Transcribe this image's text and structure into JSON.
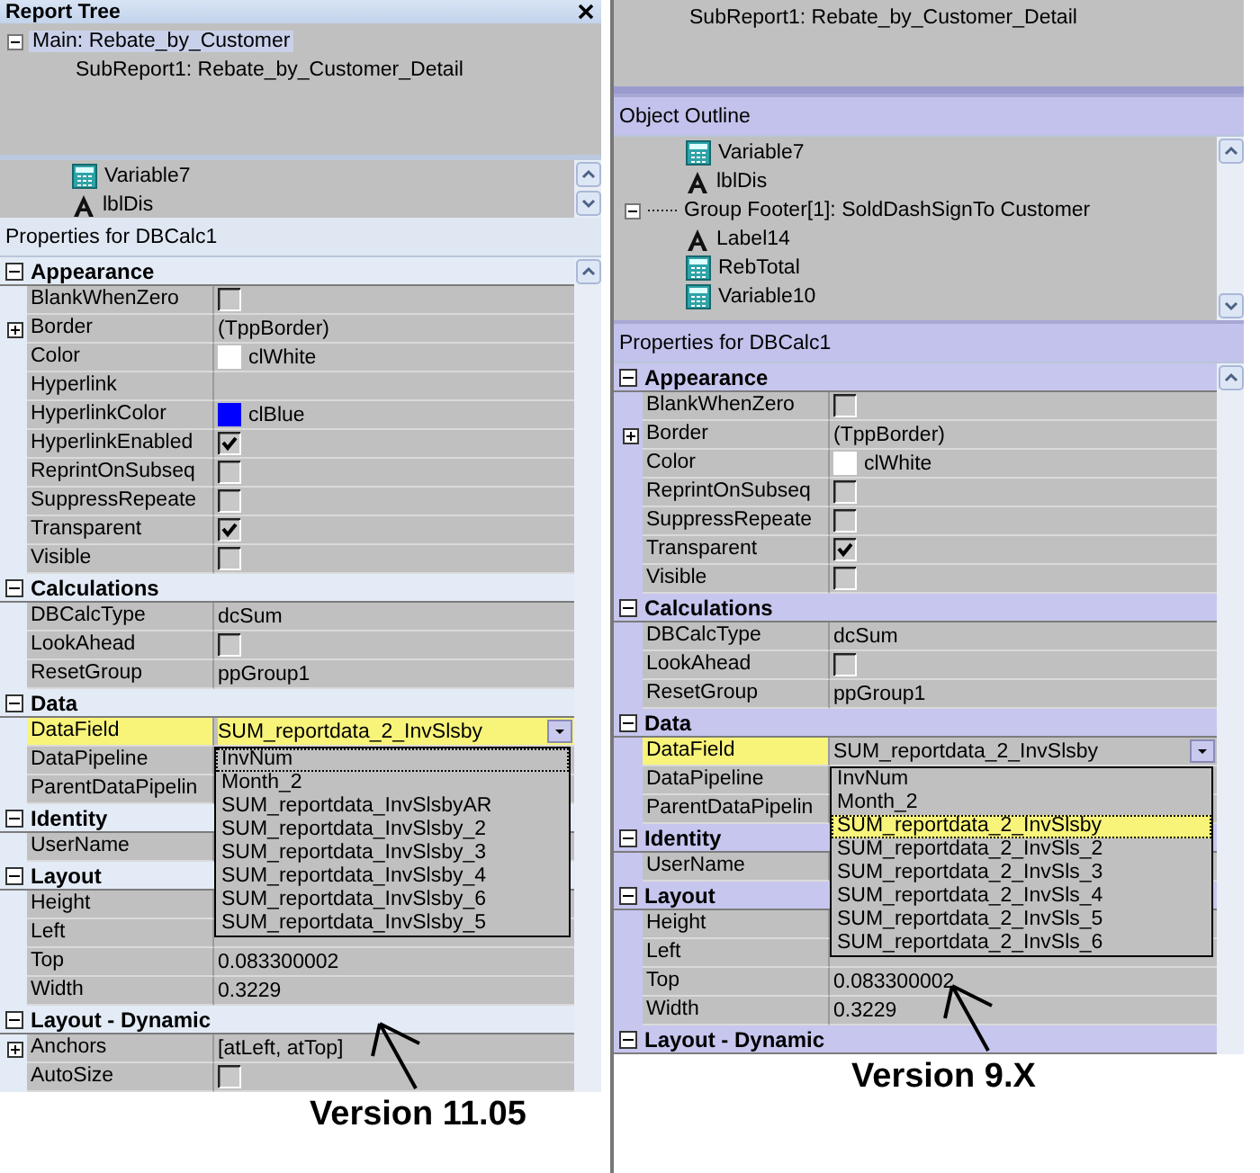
{
  "panels": [
    {
      "report_tree": {
        "title": "Report Tree",
        "items": [
          {
            "label": "Main: Rebate_by_Customer",
            "expanded": true,
            "selected": true,
            "children": [
              {
                "label": "SubReport1: Rebate_by_Customer_Detail",
                "selected": false
              }
            ]
          }
        ]
      },
      "outline": {
        "items": [
          {
            "label": "Variable7",
            "kind": "calc"
          },
          {
            "label": "lblDis",
            "kind": "label"
          }
        ]
      },
      "properties_title": "Properties for DBCalc1",
      "categories": [
        {
          "name": "Appearance",
          "expanded": true,
          "rows": [
            {
              "name": "BlankWhenZero",
              "kind": "checkbox",
              "checked": false,
              "selected": false
            },
            {
              "name": "Border",
              "kind": "expandable",
              "expanded": false,
              "value": "(TppBorder)",
              "selected": false
            },
            {
              "name": "Color",
              "kind": "color",
              "color": "#ffffff",
              "value": "clWhite",
              "selected": false
            },
            {
              "name": "Hyperlink",
              "kind": "text",
              "selected": false
            },
            {
              "name": "HyperlinkColor",
              "kind": "color",
              "color": "#0000ff",
              "value": "clBlue",
              "selected": false
            },
            {
              "name": "HyperlinkEnabled",
              "kind": "checkbox",
              "checked": true,
              "selected": false
            },
            {
              "name": "ReprintOnSubseq",
              "kind": "checkbox",
              "checked": false,
              "selected": false
            },
            {
              "name": "SuppressRepeate",
              "kind": "checkbox",
              "checked": false,
              "selected": false
            },
            {
              "name": "Transparent",
              "kind": "checkbox",
              "checked": true,
              "selected": false
            },
            {
              "name": "Visible",
              "kind": "checkbox",
              "checked": false,
              "selected": false
            }
          ]
        },
        {
          "name": "Calculations",
          "expanded": true,
          "rows": [
            {
              "name": "DBCalcType",
              "kind": "text",
              "value": "dcSum",
              "selected": false
            },
            {
              "name": "LookAhead",
              "kind": "checkbox",
              "checked": false,
              "selected": false
            },
            {
              "name": "ResetGroup",
              "kind": "text",
              "value": "ppGroup1",
              "selected": false
            }
          ]
        },
        {
          "name": "Data",
          "expanded": true,
          "rows": [
            {
              "name": "DataField",
              "kind": "dropdown",
              "value": "SUM_reportdata_2_InvSlsby",
              "selected": true,
              "options": [
                {
                  "label": "InvNum",
                  "selected": false,
                  "focused": true
                },
                {
                  "label": "Month_2",
                  "selected": false,
                  "focused": false
                },
                {
                  "label": "SUM_reportdata_InvSlsbyAR",
                  "selected": false,
                  "focused": false
                },
                {
                  "label": "SUM_reportdata_InvSlsby_2",
                  "selected": false,
                  "focused": false
                },
                {
                  "label": "SUM_reportdata_InvSlsby_3",
                  "selected": false,
                  "focused": false
                },
                {
                  "label": "SUM_reportdata_InvSlsby_4",
                  "selected": false,
                  "focused": false
                },
                {
                  "label": "SUM_reportdata_InvSlsby_6",
                  "selected": false,
                  "focused": false
                },
                {
                  "label": "SUM_reportdata_InvSlsby_5",
                  "selected": false,
                  "focused": false
                }
              ]
            },
            {
              "name": "DataPipeline",
              "kind": "text",
              "selected": false
            },
            {
              "name": "ParentDataPipelin",
              "kind": "text",
              "selected": false
            }
          ]
        },
        {
          "name": "Identity",
          "expanded": true,
          "rows": [
            {
              "name": "UserName",
              "kind": "text",
              "selected": false
            }
          ]
        },
        {
          "name": "Layout",
          "expanded": true,
          "rows": [
            {
              "name": "Height",
              "kind": "text",
              "selected": false
            },
            {
              "name": "Left",
              "kind": "text",
              "selected": false
            },
            {
              "name": "Top",
              "kind": "text",
              "value": "0.083300002",
              "selected": false
            },
            {
              "name": "Width",
              "kind": "text",
              "value": "0.3229",
              "selected": false
            }
          ]
        },
        {
          "name": "Layout - Dynamic",
          "expanded": true,
          "rows": [
            {
              "name": "Anchors",
              "kind": "expandable",
              "expanded": false,
              "value": "[atLeft, atTop]",
              "selected": false
            },
            {
              "name": "AutoSize",
              "kind": "checkbox",
              "checked": false,
              "selected": false
            }
          ]
        }
      ],
      "version_caption": "Version 11.05"
    },
    {
      "report_tree": {
        "items": [
          {
            "label": "SubReport1: Rebate_by_Customer_Detail",
            "selected": false
          }
        ]
      },
      "outline": {
        "title": "Object Outline",
        "items": [
          {
            "label": "Variable7",
            "kind": "calc"
          },
          {
            "label": "lblDis",
            "kind": "label"
          },
          {
            "label": "Group Footer[1]: SoldDashSignTo Customer",
            "kind": "band",
            "expanded": true,
            "children": [
              {
                "label": "Label14",
                "kind": "label"
              },
              {
                "label": "RebTotal",
                "kind": "calc"
              },
              {
                "label": "Variable10",
                "kind": "calc"
              }
            ]
          }
        ]
      },
      "properties_title": "Properties for DBCalc1",
      "categories": [
        {
          "name": "Appearance",
          "expanded": true,
          "rows": [
            {
              "name": "BlankWhenZero",
              "kind": "checkbox",
              "checked": false,
              "selected": false
            },
            {
              "name": "Border",
              "kind": "expandable",
              "expanded": false,
              "value": "(TppBorder)",
              "selected": false
            },
            {
              "name": "Color",
              "kind": "color",
              "color": "#ffffff",
              "value": "clWhite",
              "selected": false
            },
            {
              "name": "ReprintOnSubseq",
              "kind": "checkbox",
              "checked": false,
              "selected": false
            },
            {
              "name": "SuppressRepeate",
              "kind": "checkbox",
              "checked": false,
              "selected": false
            },
            {
              "name": "Transparent",
              "kind": "checkbox",
              "checked": true,
              "selected": false
            },
            {
              "name": "Visible",
              "kind": "checkbox",
              "checked": false,
              "selected": false
            }
          ]
        },
        {
          "name": "Calculations",
          "expanded": true,
          "rows": [
            {
              "name": "DBCalcType",
              "kind": "text",
              "value": "dcSum",
              "selected": false
            },
            {
              "name": "LookAhead",
              "kind": "checkbox",
              "checked": false,
              "selected": false
            },
            {
              "name": "ResetGroup",
              "kind": "text",
              "value": "ppGroup1",
              "selected": false
            }
          ]
        },
        {
          "name": "Data",
          "expanded": true,
          "rows": [
            {
              "name": "DataField",
              "kind": "dropdown",
              "value": "SUM_reportdata_2_InvSlsby",
              "selected": true,
              "options": [
                {
                  "label": "InvNum",
                  "selected": false,
                  "focused": false
                },
                {
                  "label": "Month_2",
                  "selected": false,
                  "focused": false
                },
                {
                  "label": "SUM_reportdata_2_InvSlsby",
                  "selected": true,
                  "focused": false
                },
                {
                  "label": "SUM_reportdata_2_InvSls_2",
                  "selected": false,
                  "focused": false
                },
                {
                  "label": "SUM_reportdata_2_InvSls_3",
                  "selected": false,
                  "focused": false
                },
                {
                  "label": "SUM_reportdata_2_InvSls_4",
                  "selected": false,
                  "focused": false
                },
                {
                  "label": "SUM_reportdata_2_InvSls_5",
                  "selected": false,
                  "focused": false
                },
                {
                  "label": "SUM_reportdata_2_InvSls_6",
                  "selected": false,
                  "focused": false
                }
              ]
            },
            {
              "name": "DataPipeline",
              "kind": "text",
              "selected": false
            },
            {
              "name": "ParentDataPipelin",
              "kind": "text",
              "selected": false
            }
          ]
        },
        {
          "name": "Identity",
          "expanded": true,
          "rows": [
            {
              "name": "UserName",
              "kind": "text",
              "selected": false
            }
          ]
        },
        {
          "name": "Layout",
          "expanded": true,
          "rows": [
            {
              "name": "Height",
              "kind": "text",
              "selected": false
            },
            {
              "name": "Left",
              "kind": "text",
              "selected": false
            },
            {
              "name": "Top",
              "kind": "text",
              "value": "0.083300002",
              "selected": false
            },
            {
              "name": "Width",
              "kind": "text",
              "value": "0.3229",
              "selected": false
            }
          ]
        },
        {
          "name": "Layout - Dynamic",
          "expanded": true
        }
      ],
      "version_caption": "Version 9.X"
    }
  ]
}
